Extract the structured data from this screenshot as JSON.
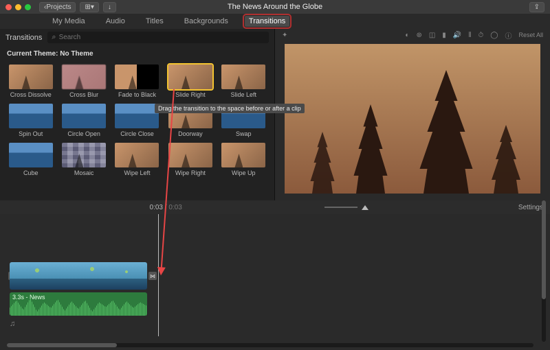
{
  "titlebar": {
    "title": "The News Around the Globe",
    "projects_label": "Projects"
  },
  "tabs": {
    "my_media": "My Media",
    "audio": "Audio",
    "titles": "Titles",
    "backgrounds": "Backgrounds",
    "transitions": "Transitions"
  },
  "browser": {
    "section_title": "Transitions",
    "search_placeholder": "Search",
    "theme_prefix": "Current Theme: ",
    "theme_value": "No Theme",
    "items": [
      "Cross Dissolve",
      "Cross Blur",
      "Fade to Black",
      "Slide Right",
      "Slide Left",
      "Spin Out",
      "Circle Open",
      "Circle Close",
      "Doorway",
      "Swap",
      "Cube",
      "Mosaic",
      "Wipe Left",
      "Wipe Right",
      "Wipe Up"
    ],
    "tooltip": "Drag the transition to the space before or after a clip"
  },
  "preview_toolbar": {
    "reset": "Reset All"
  },
  "timehead": {
    "current": "0:03",
    "total": "0:03",
    "settings": "Settings"
  },
  "timeline": {
    "audio_clip_label": "3.3s - News",
    "music_glyph": "♫"
  }
}
